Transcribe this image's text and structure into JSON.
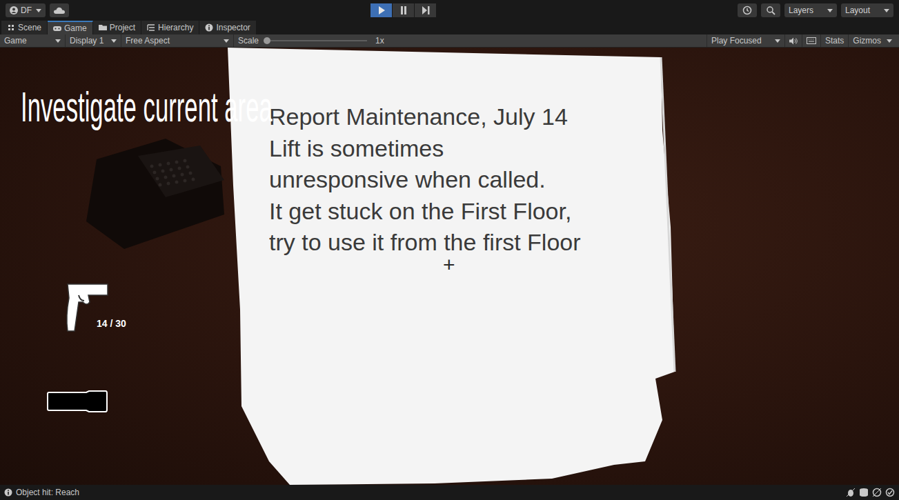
{
  "toolbar": {
    "account": "DF",
    "playing": true,
    "paused": false,
    "layers": "Layers",
    "layout": "Layout"
  },
  "tabs": [
    {
      "label": "Scene",
      "selected": false
    },
    {
      "label": "Game",
      "selected": true
    },
    {
      "label": "Project",
      "selected": false
    },
    {
      "label": "Hierarchy",
      "selected": false
    },
    {
      "label": "Inspector",
      "selected": false
    }
  ],
  "game_toolbar": {
    "view": "Game",
    "display": "Display 1",
    "aspect": "Free Aspect",
    "scale_label": "Scale",
    "scale_level": 0,
    "scale_value": "1x",
    "play_mode": "Play Focused",
    "stats": "Stats",
    "gizmos": "Gizmos"
  },
  "game": {
    "objective": "Investigate current area",
    "note_lines": [
      "Report Maintenance, July 14",
      "Lift is sometimes",
      "unresponsive when called.",
      "It get stuck on the First Floor,",
      "try to use it from the first Floor"
    ],
    "crosshair": "+",
    "ammo": "14 / 30"
  },
  "status_bar": {
    "message": "Object hit: Reach"
  }
}
